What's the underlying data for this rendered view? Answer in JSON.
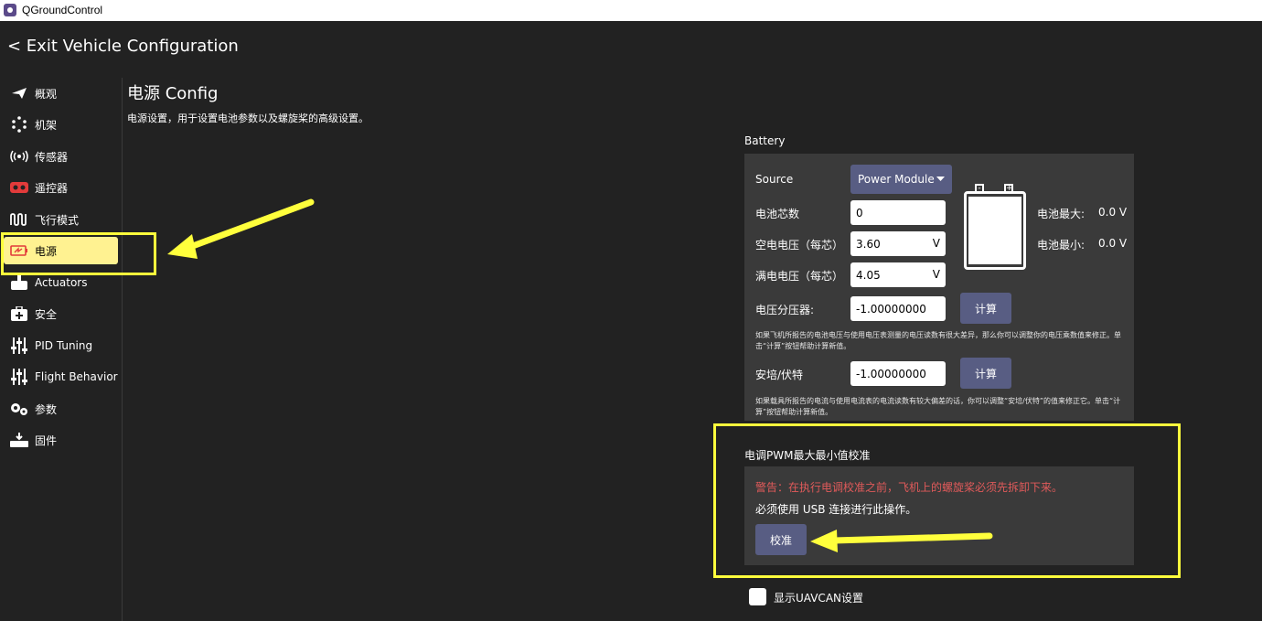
{
  "window": {
    "title": "QGroundControl"
  },
  "header": {
    "exit_label": "< Exit Vehicle Configuration"
  },
  "sidebar": {
    "items": [
      {
        "label": "概观",
        "icon": "plane-icon"
      },
      {
        "label": "机架",
        "icon": "airframe-icon"
      },
      {
        "label": "传感器",
        "icon": "sensors-icon"
      },
      {
        "label": "遥控器",
        "icon": "radio-icon"
      },
      {
        "label": "飞行模式",
        "icon": "flight-modes-icon"
      },
      {
        "label": "电源",
        "icon": "power-icon",
        "active": true
      },
      {
        "label": "Actuators",
        "icon": "actuators-icon"
      },
      {
        "label": "安全",
        "icon": "safety-icon"
      },
      {
        "label": "PID Tuning",
        "icon": "tuning-icon"
      },
      {
        "label": "Flight Behavior",
        "icon": "flight-behavior-icon"
      },
      {
        "label": "参数",
        "icon": "parameters-icon"
      },
      {
        "label": "固件",
        "icon": "firmware-icon"
      }
    ]
  },
  "page": {
    "title": "电源 Config",
    "description": "电源设置，用于设置电池参数以及螺旋桨的高级设置。"
  },
  "battery": {
    "section_label": "Battery",
    "source_label": "Source",
    "source_value": "Power Module",
    "cells_label": "电池芯数",
    "cells_value": "0",
    "empty_voltage_label": "空电电压（每芯）",
    "empty_voltage_value": "3.60",
    "full_voltage_label": "满电电压（每芯）",
    "full_voltage_value": "4.05",
    "voltage_unit": "V",
    "divider_label": "电压分压器:",
    "divider_value": "-1.00000000",
    "calc_label": "计算",
    "divider_help": "如果飞机所报告的电池电压与使用电压表测量的电压读数有很大差异，那么你可以调整你的电压乘数值来修正。单击“计算”按钮帮助计算新值。",
    "amps_label": "安培/伏特",
    "amps_value": "-1.00000000",
    "amps_help": "如果载具所报告的电流与使用电流表的电流读数有较大偏差的话，你可以调整“安培/伏特”的值来修正它。单击“计算”按钮帮助计算新值。",
    "max_label": "电池最大:",
    "max_value": "0.0 V",
    "min_label": "电池最小:",
    "min_value": "0.0 V"
  },
  "esc": {
    "section_label": "电调PWM最大最小值校准",
    "warning": "警告：在执行电调校准之前，飞机上的螺旋桨必须先拆卸下来。",
    "note": "必须使用 USB 连接进行此操作。",
    "calibrate_label": "校准"
  },
  "uavcan": {
    "checkbox_label": "显示UAVCAN设置",
    "checked": false
  },
  "colors": {
    "background": "#222222",
    "panel": "#3a3a3a",
    "button": "#585d83",
    "active_nav": "#fff291",
    "highlight": "#ffff3c",
    "warning": "#e05a5a"
  }
}
